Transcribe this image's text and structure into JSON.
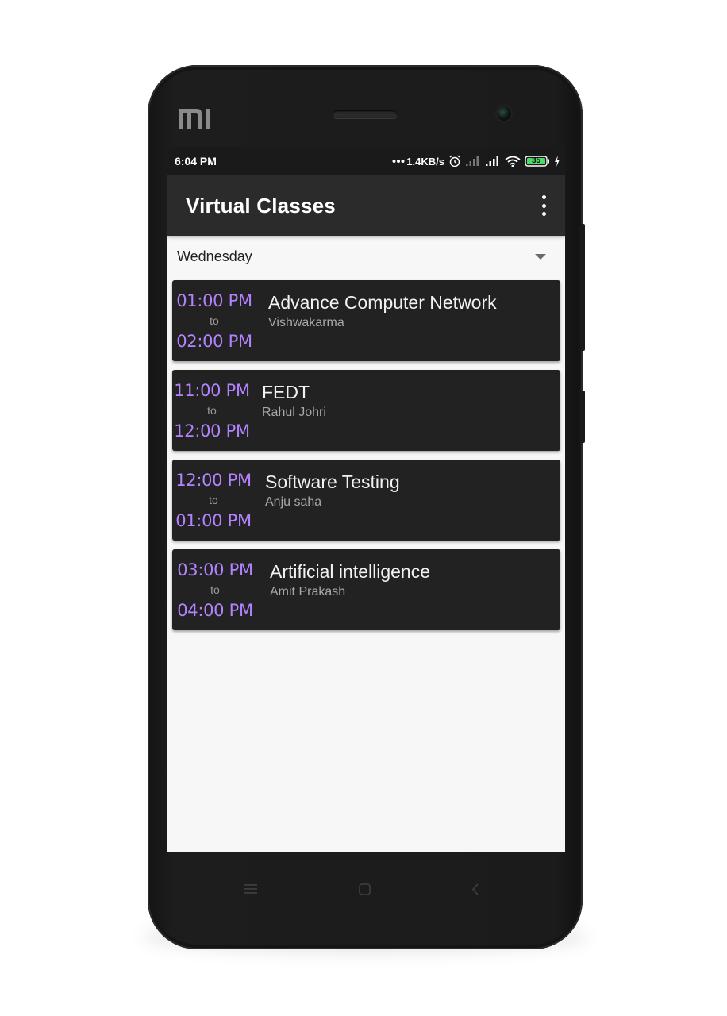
{
  "status_bar": {
    "time": "6:04 PM",
    "network_speed": "1.4KB/s",
    "battery": "35",
    "icons": [
      "dots-icon",
      "alarm-icon",
      "signal-weak-icon",
      "signal-icon",
      "wifi-icon",
      "battery-icon",
      "charging-icon"
    ]
  },
  "app_bar": {
    "title": "Virtual Classes",
    "menu_icon": "overflow-menu-icon"
  },
  "day_selector": {
    "selected": "Wednesday"
  },
  "classes": [
    {
      "start": "01:00 PM",
      "separator": "to",
      "end": "02:00 PM",
      "subject": "Advance Computer Network",
      "teacher": "Vishwakarma"
    },
    {
      "start": "11:00 PM",
      "separator": "to",
      "end": "12:00 PM",
      "subject": "FEDT",
      "teacher": "Rahul Johri"
    },
    {
      "start": "12:00 PM",
      "separator": "to",
      "end": "01:00 PM",
      "subject": "Software Testing",
      "teacher": "Anju saha"
    },
    {
      "start": "03:00 PM",
      "separator": "to",
      "end": "04:00 PM",
      "subject": "Artificial intelligence",
      "teacher": "Amit Prakash"
    }
  ],
  "device": {
    "brand_logo": "MI"
  },
  "colors": {
    "accent_time": "#b383ff",
    "app_bar": "#2b2b2b",
    "card": "#222222",
    "status_bar": "#1a1a1a"
  }
}
